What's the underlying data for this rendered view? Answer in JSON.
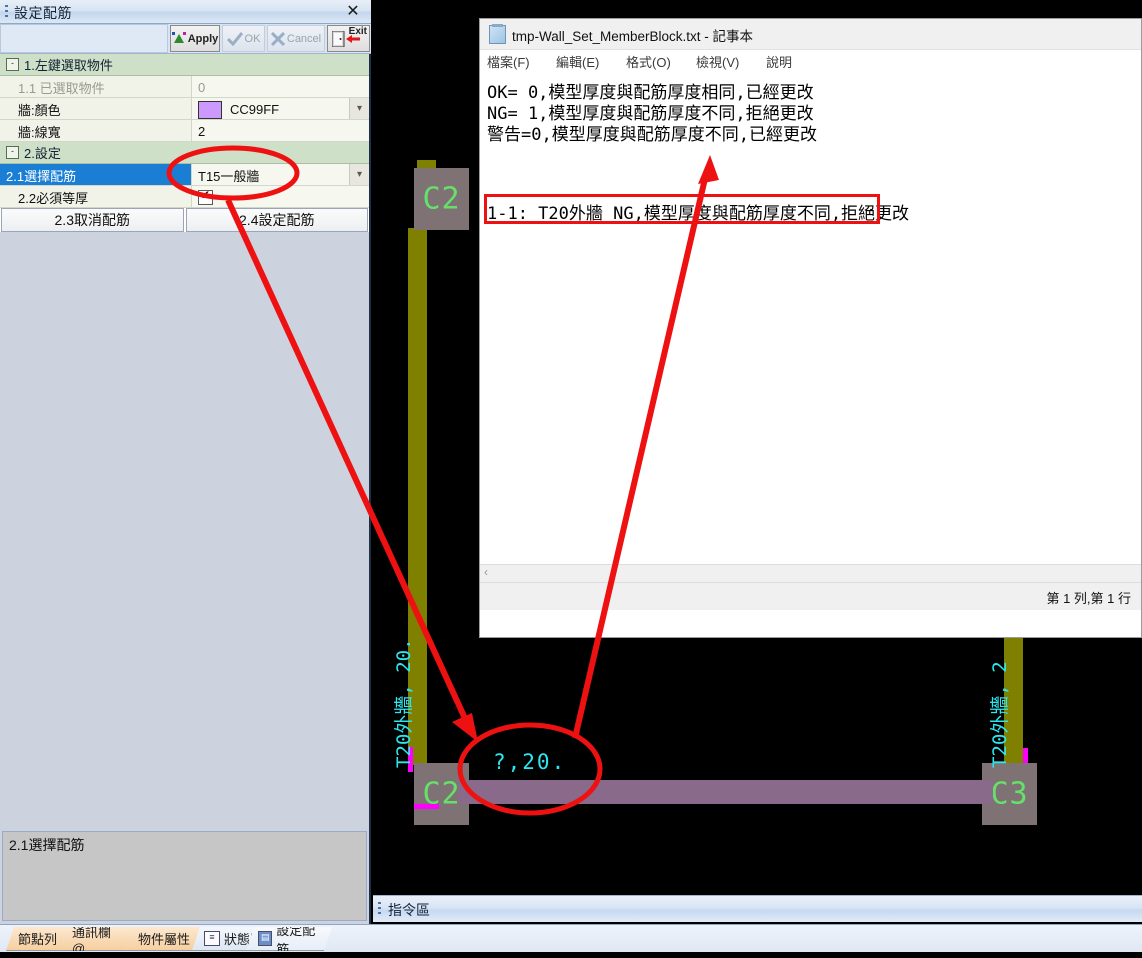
{
  "dock": {
    "title": "設定配筋",
    "close_icon": "✕",
    "toolbar": [
      {
        "label": "Apply",
        "icon": "apply-icon",
        "enabled": true
      },
      {
        "label": "OK",
        "icon": "check-icon",
        "enabled": false
      },
      {
        "label": "Cancel",
        "icon": "cross-icon",
        "enabled": false
      },
      {
        "label": "Exit",
        "icon": "door-arrow-icon",
        "enabled": true
      }
    ],
    "groups": [
      {
        "label": "1.左鍵選取物件",
        "expander": "-",
        "rows": [
          {
            "name": "1.1 已選取物件",
            "value": "0",
            "type": "text",
            "muted": true,
            "selected": false
          },
          {
            "name": "牆:顏色",
            "value": "CC99FF",
            "type": "color",
            "swatch": "#cc99ff",
            "dropdown": true,
            "selected": false
          },
          {
            "name": "牆:線寬",
            "value": "2",
            "type": "text",
            "selected": false
          }
        ]
      },
      {
        "label": "2.設定",
        "expander": "-",
        "rows": [
          {
            "name": "2.1選擇配筋",
            "value": "T15一般牆",
            "type": "text",
            "dropdown": true,
            "selected": true
          },
          {
            "name": "2.2必須等厚",
            "value": "",
            "type": "checkbox",
            "checked": true,
            "selected": false
          }
        ]
      }
    ],
    "action_buttons": [
      {
        "label": "2.3取消配筋"
      },
      {
        "label": "2.4設定配筋"
      }
    ],
    "description": "2.1選擇配筋"
  },
  "notepad": {
    "title": "tmp-Wall_Set_MemberBlock.txt - 記事本",
    "menu": [
      "檔案(F)",
      "編輯(E)",
      "格式(O)",
      "檢視(V)",
      "說明"
    ],
    "lines": [
      "OK= 0,模型厚度與配筋厚度相同,已經更改",
      "NG= 1,模型厚度與配筋厚度不同,拒絕更改",
      "警告=0,模型厚度與配筋厚度不同,已經更改",
      "1-1: T20外牆 NG,模型厚度與配筋厚度不同,拒絕更改"
    ],
    "highlighted_line_index": 3,
    "status": "第 1 列,第 1 行",
    "scroll_arrow": "‹"
  },
  "cad": {
    "labels": {
      "column_left_top": "C2",
      "column_left_bottom": "C2",
      "column_right_bottom": "C3",
      "vtext_left": "T20外牆, 20.",
      "vtext_right": "T20外牆, 2",
      "htext_circled": "?,20."
    },
    "colors": {
      "background": "#000000",
      "wall_vertical": "#808000",
      "wall_horizontal": "#8a6a8a",
      "column_fill": "#7f7275",
      "column_text": "#66e06b",
      "dimension_text": "#2ce6f0",
      "marker": "#ff00ff",
      "annotation": "#ee1111"
    }
  },
  "command_bar": {
    "label": "指令區"
  },
  "tabs": [
    {
      "label": "節點列",
      "icon": null,
      "active": false
    },
    {
      "label": "通訊欄@",
      "icon": null,
      "active": false
    },
    {
      "label": "物件屬性",
      "icon": null,
      "active": false
    },
    {
      "label": "狀態區",
      "icon": "list-icon",
      "active": false
    },
    {
      "label": "設定配筋",
      "icon": "grid-icon",
      "active": true
    }
  ]
}
